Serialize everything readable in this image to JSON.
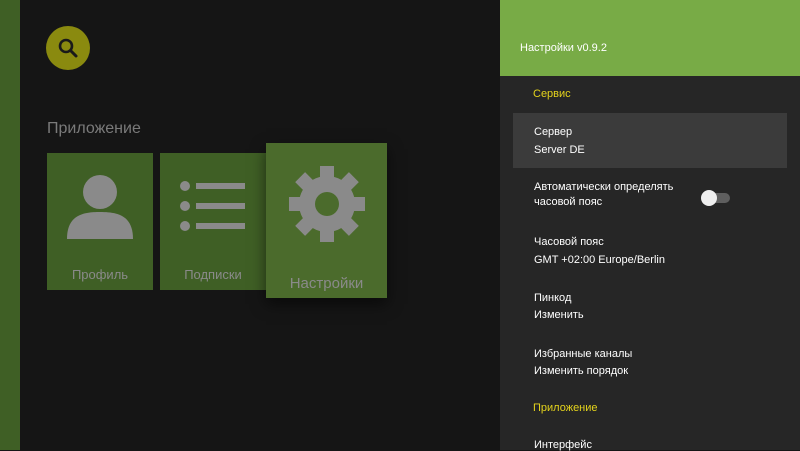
{
  "main": {
    "search_icon": "search-icon",
    "section_title": "Приложение",
    "tiles": [
      {
        "label": "Профиль",
        "icon": "profile-icon"
      },
      {
        "label": "Подписки",
        "icon": "list-icon"
      },
      {
        "label": "Настройки",
        "icon": "gear-icon"
      }
    ]
  },
  "settings": {
    "title": "Настройки v0.9.2",
    "sections": [
      {
        "label": "Сервис"
      },
      {
        "label": "Приложение"
      }
    ],
    "items": [
      {
        "title": "Сервер",
        "value": "Server DE"
      },
      {
        "title": "Автоматически определять",
        "title2": "часовой пояс",
        "toggle": "off"
      },
      {
        "title": "Часовой пояс",
        "value": "GMT +02:00 Europe/Berlin"
      },
      {
        "title": "Пинкод",
        "value": "Изменить"
      },
      {
        "title": "Избранные каналы",
        "value": "Изменить порядок"
      },
      {
        "title": "Интерфейс"
      }
    ]
  },
  "colors": {
    "accent_green": "#78ab46",
    "tile_green": "#3f5f25",
    "section_yellow": "#e4d31c",
    "search_button": "#8a8a0f"
  }
}
